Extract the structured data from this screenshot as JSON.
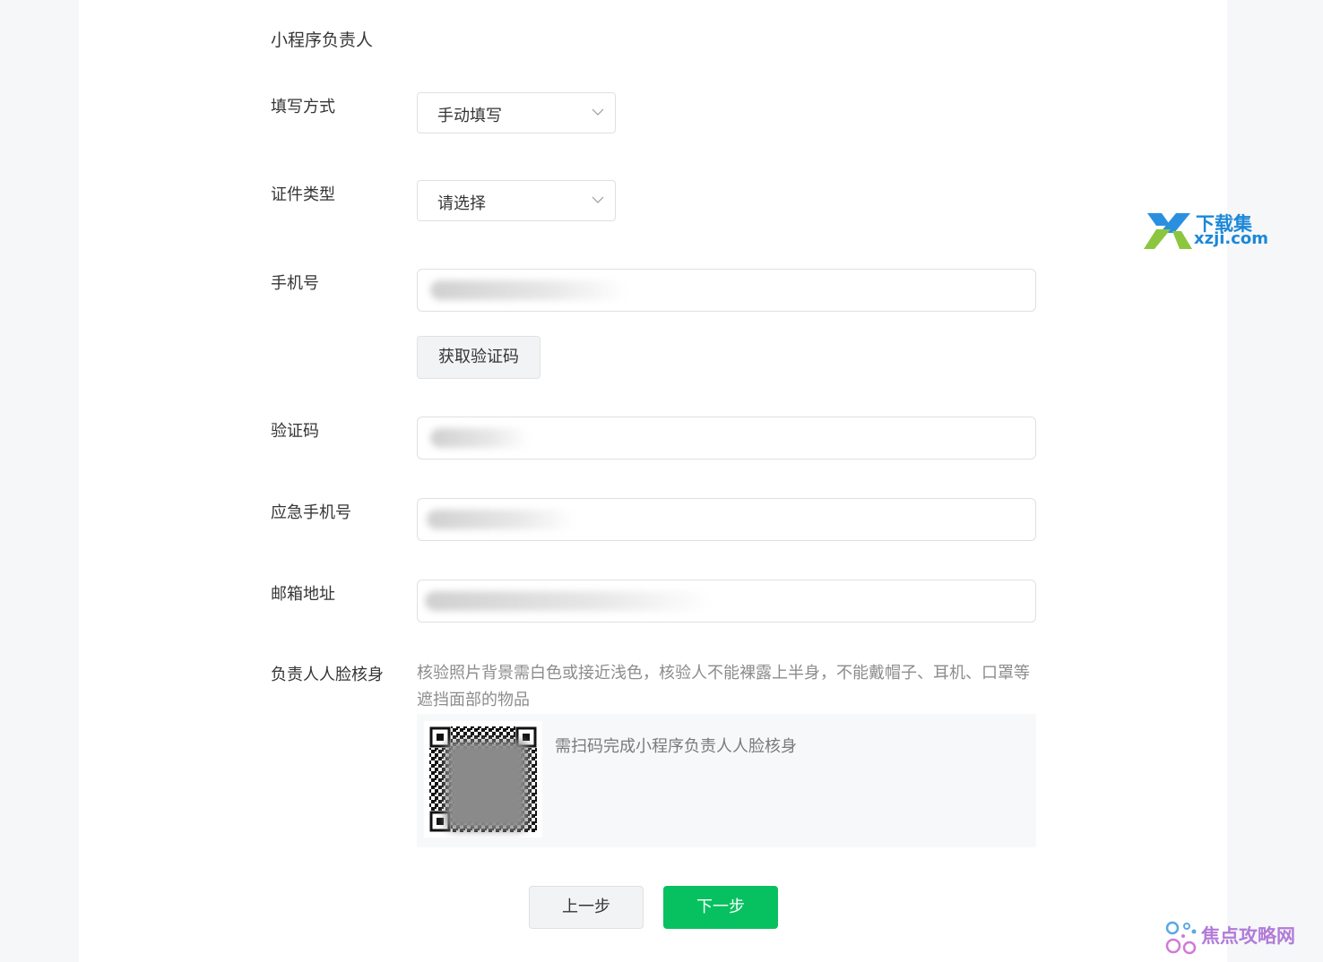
{
  "section": {
    "title": "小程序负责人"
  },
  "form": {
    "fill_method": {
      "label": "填写方式",
      "value": "手动填写"
    },
    "id_type": {
      "label": "证件类型",
      "value": "请选择"
    },
    "phone": {
      "label": "手机号"
    },
    "get_code_button": "获取验证码",
    "verify_code": {
      "label": "验证码"
    },
    "emergency_phone": {
      "label": "应急手机号"
    },
    "email": {
      "label": "邮箱地址"
    },
    "face_verify": {
      "label": "负责人人脸核身",
      "hint": "核验照片背景需白色或接近浅色，核验人不能裸露上半身，不能戴帽子、耳机、口罩等遮挡面部的物品",
      "qr_caption": "需扫码完成小程序负责人人脸核身",
      "qr_icon": "qr-code-icon"
    }
  },
  "actions": {
    "prev": "上一步",
    "next": "下一步"
  },
  "watermarks": {
    "top": {
      "line1": "下载集",
      "line2": "xzji.com"
    },
    "bottom": {
      "name": "焦点攻略网"
    }
  },
  "colors": {
    "primary": "#07c160",
    "watermark_blue": "#1c88d8",
    "watermark_purple": "#b27bd8"
  }
}
